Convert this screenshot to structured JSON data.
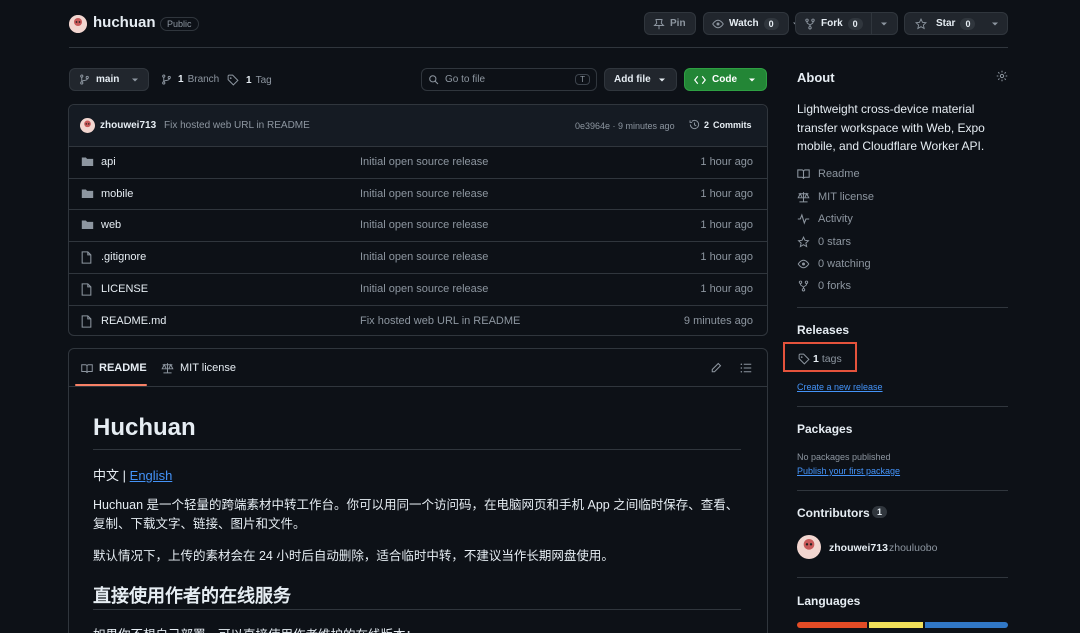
{
  "repo": {
    "name": "huchuan",
    "visibility": "Public"
  },
  "header_actions": {
    "pin": "Pin",
    "watch": "Watch",
    "watch_count": "0",
    "fork": "Fork",
    "fork_count": "0",
    "star": "Star",
    "star_count": "0"
  },
  "toolbar": {
    "branch": "main",
    "branches_count": "1",
    "branches_label": "Branch",
    "tags_count": "1",
    "tags_label": "Tag",
    "search_placeholder": "Go to file",
    "search_shortcut": "T",
    "add_file": "Add file",
    "code": "Code"
  },
  "commit": {
    "author": "zhouwei713",
    "message": "Fix hosted web URL in README",
    "hash_time": "0e3964e · 9 minutes ago",
    "commits_count": "2",
    "commits_label": "Commits"
  },
  "files": [
    {
      "type": "folder",
      "name": "api",
      "message": "Initial open source release",
      "time": "1 hour ago"
    },
    {
      "type": "folder",
      "name": "mobile",
      "message": "Initial open source release",
      "time": "1 hour ago"
    },
    {
      "type": "folder",
      "name": "web",
      "message": "Initial open source release",
      "time": "1 hour ago"
    },
    {
      "type": "file",
      "name": ".gitignore",
      "message": "Initial open source release",
      "time": "1 hour ago"
    },
    {
      "type": "file",
      "name": "LICENSE",
      "message": "Initial open source release",
      "time": "1 hour ago"
    },
    {
      "type": "file",
      "name": "README.md",
      "message": "Fix hosted web URL in README",
      "time": "9 minutes ago"
    }
  ],
  "readme": {
    "tab_readme": "README",
    "tab_license": "MIT license",
    "title": "Huchuan",
    "lang_current": "中文",
    "lang_sep": "|",
    "lang_link": "English",
    "para1_line1": "Huchuan 是一个轻量的跨端素材中转工作台。你可以用同一个访问码，在电脑网页和手机 App 之间临时保存、查看、",
    "para1_line2": "复制、下载文字、链接、图片和文件。",
    "para2": "默认情况下，上传的素材会在 24 小时后自动删除，适合临时中转，不建议当作长期网盘使用。",
    "h2": "直接使用作者的在线服务",
    "para3": "如果你不想自己部署，可以直接使用作者维护的在线版本："
  },
  "about": {
    "heading": "About",
    "description_lines": [
      "Lightweight cross-device material",
      "transfer workspace with Web, Expo",
      "mobile, and Cloudflare Worker API."
    ],
    "items": [
      {
        "icon": "book-icon",
        "label": "Readme"
      },
      {
        "icon": "scale-icon",
        "label": "MIT license"
      },
      {
        "icon": "pulse-icon",
        "label": "Activity"
      },
      {
        "icon": "star-icon",
        "label": "0 stars"
      },
      {
        "icon": "eye-icon",
        "label": "0 watching"
      },
      {
        "icon": "fork-icon",
        "label": "0 forks"
      }
    ]
  },
  "releases": {
    "heading": "Releases",
    "tags_count": "1",
    "tags_label": "tags",
    "create_link": "Create a new release"
  },
  "packages": {
    "heading": "Packages",
    "empty": "No packages published",
    "publish_link": "Publish your first package"
  },
  "contributors": {
    "heading": "Contributors",
    "count": "1",
    "user": "zhouwei713",
    "user_alt": "zhouluobo"
  },
  "languages": {
    "heading": "Languages",
    "bar_colors": [
      "#e34c26",
      "#f1e05a",
      "#3178c6"
    ],
    "bar_shares": [
      0.34,
      0.26,
      0.4
    ]
  },
  "colors": {
    "accent_green": "#238636",
    "link_blue": "#4493f8",
    "highlight_box": "#e5533c"
  }
}
